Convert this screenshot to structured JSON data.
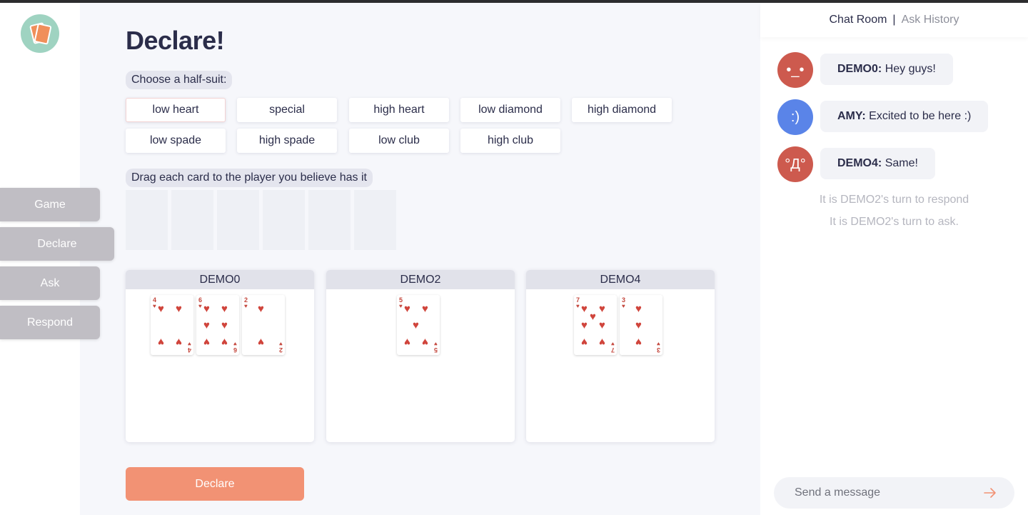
{
  "colors": {
    "accent": "#f29274",
    "nav_bg": "#c0bec4",
    "heart": "#d0453c",
    "panel_bg": "#f6f7fb"
  },
  "logo": {
    "icon": "cards-logo-icon"
  },
  "main": {
    "title": "Declare!",
    "half_suit_prompt": "Choose a half-suit:",
    "half_suits": [
      {
        "label": "low heart",
        "selected": true
      },
      {
        "label": "special"
      },
      {
        "label": "high heart"
      },
      {
        "label": "low diamond"
      },
      {
        "label": "high diamond"
      },
      {
        "label": "low spade"
      },
      {
        "label": "high spade"
      },
      {
        "label": "low club"
      },
      {
        "label": "high club"
      }
    ],
    "drag_prompt": "Drag each card to the player you believe has it",
    "empty_slots": 6,
    "players": [
      {
        "name": "DEMO0",
        "cards": [
          {
            "rank": "4",
            "suit": "heart"
          },
          {
            "rank": "6",
            "suit": "heart"
          },
          {
            "rank": "2",
            "suit": "heart"
          }
        ]
      },
      {
        "name": "DEMO2",
        "cards": [
          {
            "rank": "5",
            "suit": "heart"
          }
        ]
      },
      {
        "name": "DEMO4",
        "cards": [
          {
            "rank": "7",
            "suit": "heart"
          },
          {
            "rank": "3",
            "suit": "heart"
          }
        ]
      }
    ],
    "declare_button": "Declare"
  },
  "nav": [
    "Game",
    "Declare",
    "Ask",
    "Respond"
  ],
  "chat": {
    "tab_active": "Chat Room",
    "tab_separator": "|",
    "tab_inactive": "Ask History",
    "messages": [
      {
        "avatar_face": "•_•",
        "avatar_color": "#cd5a4e",
        "sender": "DEMO0:",
        "text": "Hey guys!"
      },
      {
        "avatar_face": ":)",
        "avatar_color": "#5a84e8",
        "sender": "AMY:",
        "text": "Excited to be here :)"
      },
      {
        "avatar_face": "°Д°",
        "avatar_color": "#cd5a4e",
        "sender": "DEMO4:",
        "text": "Same!"
      }
    ],
    "system_messages": [
      "It is DEMO2's turn to respond",
      "It is DEMO2's turn to ask."
    ],
    "input_placeholder": "Send a message",
    "send_icon": "arrow-right-icon"
  }
}
